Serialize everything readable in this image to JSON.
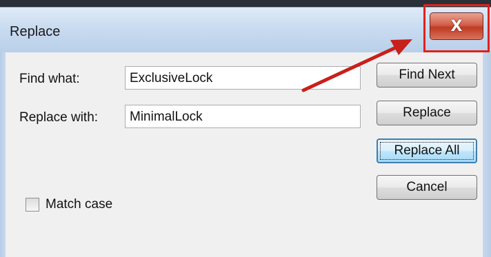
{
  "window": {
    "title": "Replace",
    "close_glyph": "X"
  },
  "form": {
    "find_label": "Find what:",
    "find_value": "ExclusiveLock",
    "replace_label": "Replace with:",
    "replace_value": "MinimalLock",
    "match_case_label": "Match case",
    "match_case_checked": false
  },
  "buttons": {
    "find_next": "Find Next",
    "replace": "Replace",
    "replace_all": "Replace All",
    "cancel": "Cancel"
  },
  "annotation": {
    "highlight_color": "#e0211b",
    "arrow_color": "#c8201a"
  }
}
